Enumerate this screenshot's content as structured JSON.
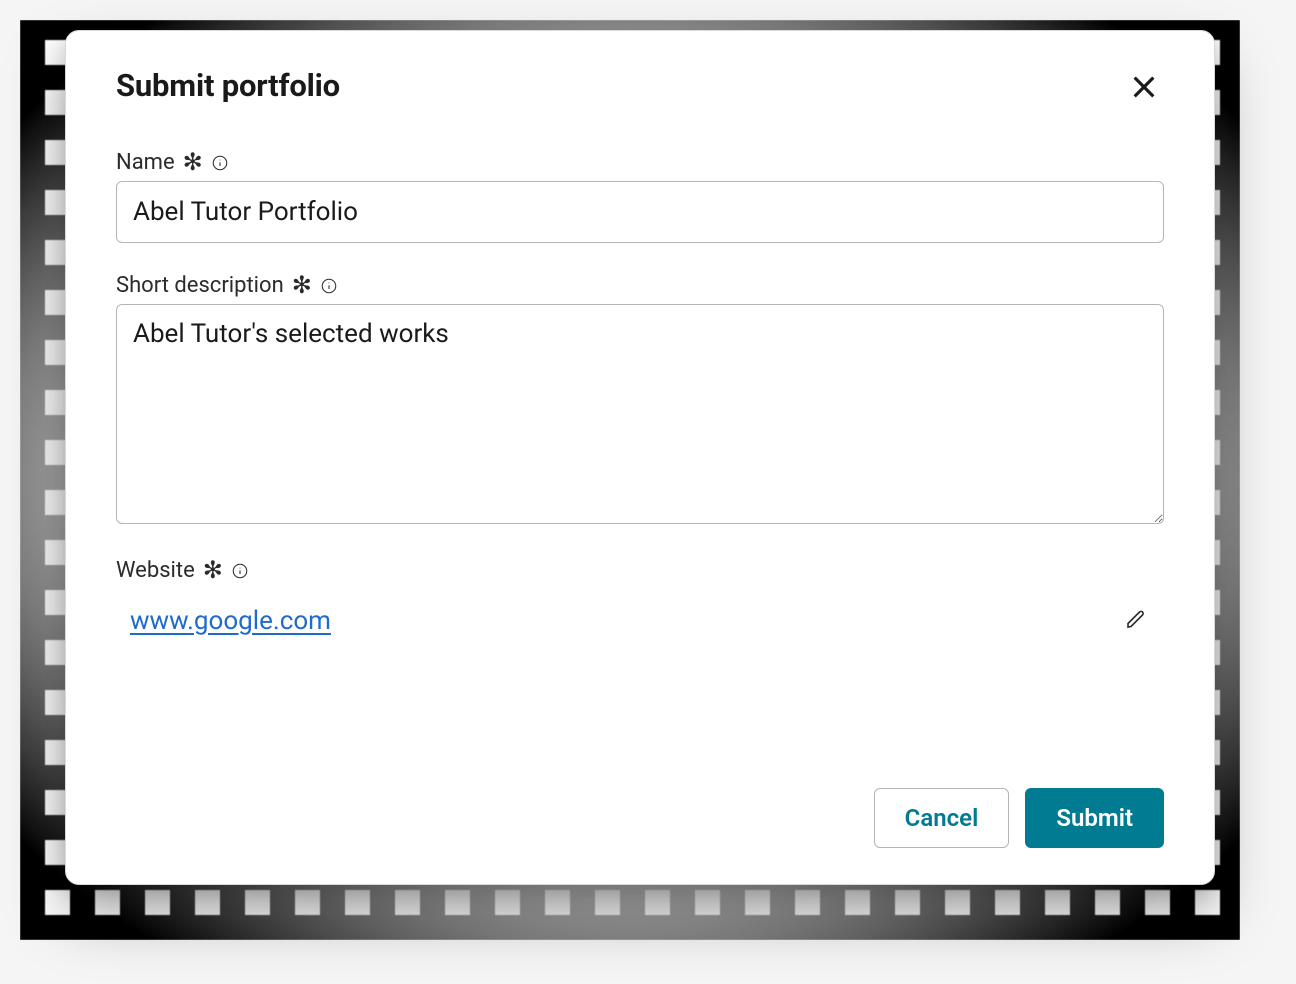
{
  "modal": {
    "title": "Submit portfolio",
    "fields": {
      "name": {
        "label": "Name",
        "value": "Abel Tutor Portfolio"
      },
      "short_description": {
        "label": "Short description",
        "value": "Abel Tutor's selected works"
      },
      "website": {
        "label": "Website",
        "link_text": "www.google.com"
      }
    },
    "buttons": {
      "cancel": "Cancel",
      "submit": "Submit"
    }
  }
}
